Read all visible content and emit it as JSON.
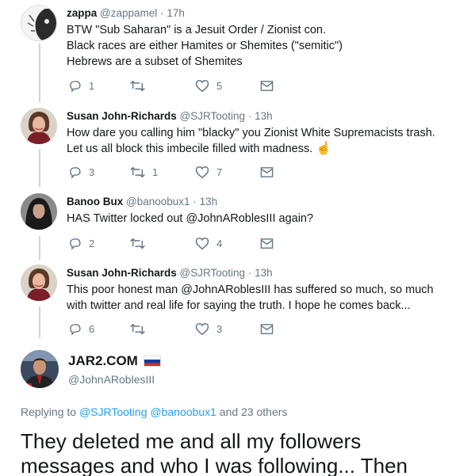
{
  "tweets": [
    {
      "name": "zappa",
      "handle": "@zappamel",
      "dot": "·",
      "time": "17h",
      "lines": [
        "BTW \"Sub Saharan\" is a Jesuit Order / Zionist con.",
        "Black races are either Hamites or Shemites (\"semitic\")",
        "Hebrews are a subset of Shemites"
      ],
      "reply_count": "1",
      "retweet_count": "",
      "like_count": "5"
    },
    {
      "name": "Susan John-Richards",
      "handle": "@SJRTooting",
      "dot": "·",
      "time": "13h",
      "lines": [
        "How dare you calling him \"blacky\" you Zionist White Supremacists trash. Let us all block this imbecile filled with madness."
      ],
      "emoji": "☝",
      "reply_count": "3",
      "retweet_count": "1",
      "like_count": "7"
    },
    {
      "name": "Banoo Bux",
      "handle": "@banoobux1",
      "dot": "·",
      "time": "13h",
      "lines": [
        "HAS Twitter locked out @JohnARoblesIII again?"
      ],
      "reply_count": "2",
      "retweet_count": "",
      "like_count": "4"
    },
    {
      "name": "Susan John-Richards",
      "handle": "@SJRTooting",
      "dot": "·",
      "time": "13h",
      "lines": [
        "This poor honest man @JohnARoblesIII has suffered so much, so much with twitter and real life for saying the truth. I hope he comes back..."
      ],
      "reply_count": "6",
      "retweet_count": "",
      "like_count": "3"
    }
  ],
  "main_tweet": {
    "name": "JAR2.COM",
    "handle": "@JohnARoblesIII",
    "replying_prefix": "Replying to",
    "replying_to_1": "@SJRTooting",
    "replying_to_2": "@banoobux1",
    "replying_suffix": "and 23 others",
    "text": "They deleted me and all my followers messages and who I was following... Then"
  },
  "colors": {
    "accent": "#1da1f2",
    "muted": "#657786",
    "thread_line": "#ccd6dd",
    "flag_white": "#ffffff",
    "flag_blue": "#0039a6",
    "flag_red": "#d52b1e"
  },
  "icons": [
    "reply-icon",
    "retweet-icon",
    "like-icon",
    "direct-message-icon",
    "russia-flag-icon",
    "pointing-hand-emoji"
  ]
}
